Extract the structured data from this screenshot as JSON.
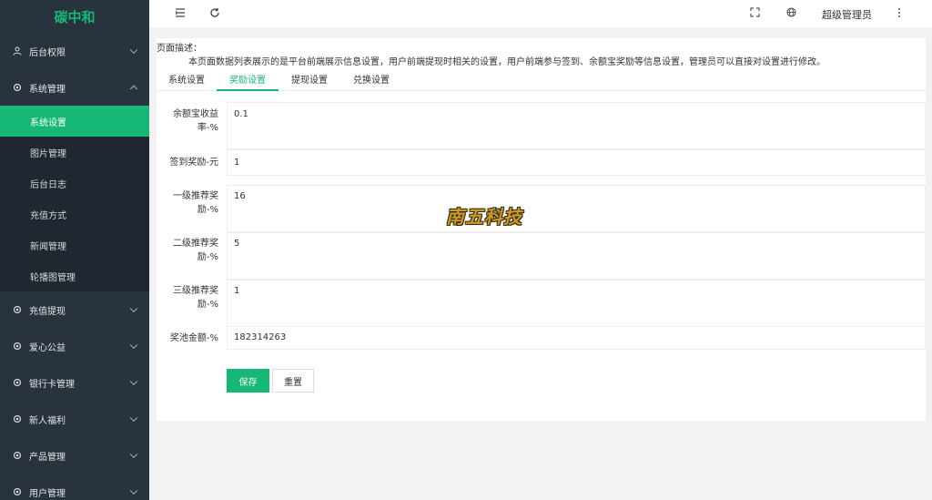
{
  "app": {
    "logo": "碳中和"
  },
  "sidebar": {
    "items": [
      {
        "label": "后台权限",
        "icon": "user-icon",
        "expanded": false
      },
      {
        "label": "系统管理",
        "icon": "gear-icon",
        "expanded": true,
        "children": [
          {
            "label": "系统设置",
            "active": true
          },
          {
            "label": "图片管理"
          },
          {
            "label": "后台日志"
          },
          {
            "label": "充值方式"
          },
          {
            "label": "新闻管理"
          },
          {
            "label": "轮播图管理"
          }
        ]
      },
      {
        "label": "充值提现",
        "icon": "gear-icon",
        "expanded": false
      },
      {
        "label": "爱心公益",
        "icon": "gear-icon",
        "expanded": false
      },
      {
        "label": "银行卡管理",
        "icon": "gear-icon",
        "expanded": false
      },
      {
        "label": "新人福利",
        "icon": "gear-icon",
        "expanded": false
      },
      {
        "label": "产品管理",
        "icon": "gear-icon",
        "expanded": false
      },
      {
        "label": "用户管理",
        "icon": "gear-icon",
        "expanded": false
      }
    ]
  },
  "topbar": {
    "menu_toggle_icon": "menu-fold-icon",
    "refresh_icon": "refresh-icon",
    "fullscreen_icon": "fullscreen-icon",
    "language_icon": "globe-icon",
    "user_name": "超级管理员",
    "more_icon": "more-vertical-icon"
  },
  "page": {
    "desc_label": "页面描述：",
    "desc_text": "本页面数据列表展示的是平台前端展示信息设置，用户前端提现时相关的设置，用户前端参与签到、余额宝奖励等信息设置，管理员可以直接对设置进行修改。",
    "tabs": [
      {
        "label": "系统设置",
        "active": false
      },
      {
        "label": "奖励设置",
        "active": true
      },
      {
        "label": "提现设置",
        "active": false
      },
      {
        "label": "兑换设置",
        "active": false
      }
    ],
    "fields": [
      {
        "label_line1": "余额宝收益",
        "label_line2": "率-%",
        "value": "0.1"
      },
      {
        "label_line1": "签到奖励-元",
        "label_line2": "",
        "value": "1"
      },
      {
        "label_line1": "一级推荐奖",
        "label_line2": "励-%",
        "value": "16"
      },
      {
        "label_line1": "二级推荐奖",
        "label_line2": "励-%",
        "value": "5"
      },
      {
        "label_line1": "三级推荐奖",
        "label_line2": "励-%",
        "value": "1"
      },
      {
        "label_line1": "奖池金额-%",
        "label_line2": "",
        "value": "182314263"
      }
    ],
    "save_label": "保存",
    "reset_label": "重置"
  },
  "watermark": {
    "text": "南五科技"
  },
  "colors": {
    "accent": "#16b777",
    "sidebar_bg": "#28333e",
    "submenu_bg": "#1f2730"
  }
}
